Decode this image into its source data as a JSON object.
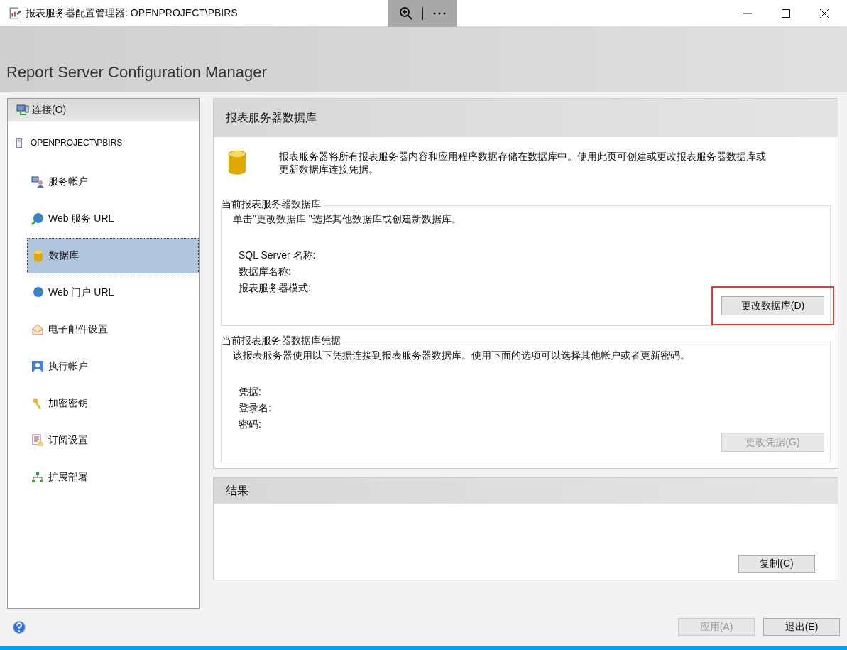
{
  "window": {
    "title": "报表服务器配置管理器: OPENPROJECT\\PBIRS"
  },
  "header": {
    "title": "Report Server Configuration Manager"
  },
  "sidebar": {
    "connect": "连接(O)",
    "server": "OPENPROJECT\\PBIRS",
    "items": [
      {
        "label": "服务帐户",
        "selected": false
      },
      {
        "label": "Web 服务 URL",
        "selected": false
      },
      {
        "label": "数据库",
        "selected": true
      },
      {
        "label": "Web 门户 URL",
        "selected": false
      },
      {
        "label": "电子邮件设置",
        "selected": false
      },
      {
        "label": "执行帐户",
        "selected": false
      },
      {
        "label": "加密密钥",
        "selected": false
      },
      {
        "label": "订阅设置",
        "selected": false
      },
      {
        "label": "扩展部署",
        "selected": false
      }
    ]
  },
  "page": {
    "title": "报表服务器数据库",
    "intro": "报表服务器将所有报表服务器内容和应用程序数据存储在数据库中。使用此页可创建或更改报表服务器数据库或更新数据库连接凭据。",
    "current_db": {
      "legend": "当前报表服务器数据库",
      "hint": "单击\"更改数据库 \"选择其他数据库或创建新数据库。",
      "fields": [
        "SQL Server 名称:",
        "数据库名称:",
        "报表服务器模式:"
      ],
      "button": {
        "label": "更改数据库(D)",
        "disabled": false,
        "highlighted": true
      }
    },
    "credentials": {
      "legend": "当前报表服务器数据库凭据",
      "hint": "该报表服务器使用以下凭据连接到报表服务器数据库。使用下面的选项可以选择其他帐户或者更新密码。",
      "fields": [
        "凭据:",
        "登录名:",
        "密码:"
      ],
      "button": {
        "label": "更改凭据(G)",
        "disabled": true
      }
    }
  },
  "results": {
    "title": "结果",
    "button": {
      "label": "复制(C)",
      "disabled": false
    }
  },
  "footer": {
    "buttons": [
      {
        "label": "应用(A)",
        "disabled": true
      },
      {
        "label": "退出(E)",
        "disabled": false
      }
    ]
  }
}
